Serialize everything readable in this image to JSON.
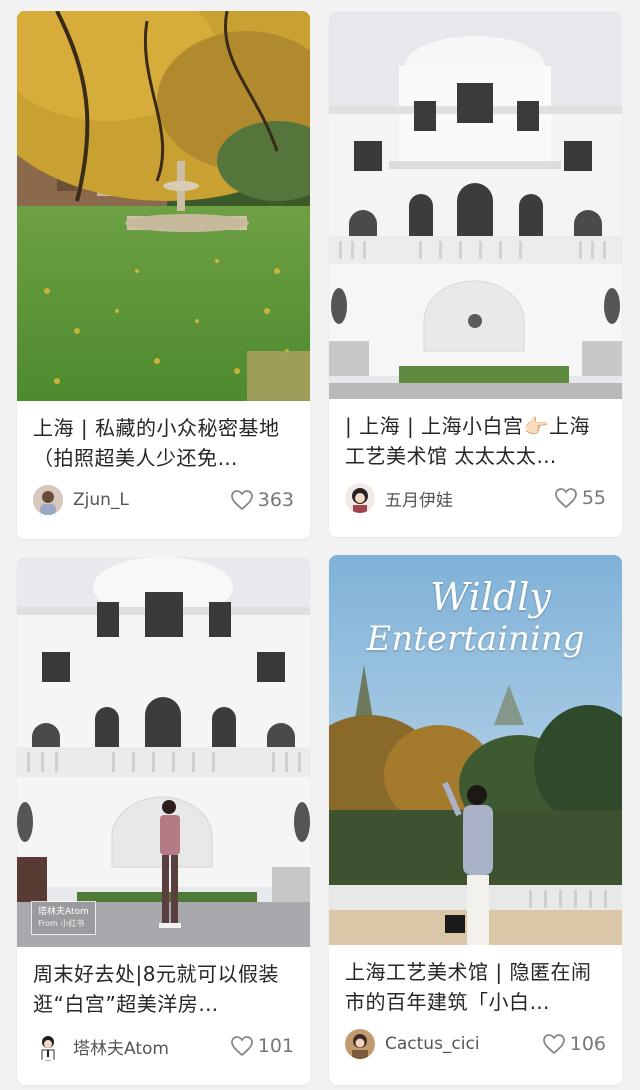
{
  "cards": [
    {
      "title": "上海 | 私藏的小众秘密基地（拍照超美人少还免…",
      "author": "Zjun_L",
      "likes": "363",
      "image_icon": "garden-photo"
    },
    {
      "title": "| 上海 | 上海小白宫👉🏻上海工艺美术馆 太太太太…",
      "author": "五月伊娃",
      "likes": "55",
      "image_icon": "white-palace-photo"
    },
    {
      "title": "周末好去处|8元就可以假装逛“白宫”超美洋房…",
      "author": "塔林夫Atom",
      "likes": "101",
      "image_icon": "white-palace-person-photo",
      "watermark": {
        "line1": "塔林夫Atom",
        "line2": "From 小红书"
      }
    },
    {
      "title": "上海工艺美术馆 | 隐匿在闹市的百年建筑「小白…",
      "author": "Cactus_cici",
      "likes": "106",
      "image_icon": "wildly-entertaining-photo",
      "overlay_text": {
        "line1": "Wildly",
        "line2": "Entertaining"
      }
    }
  ],
  "colors": {
    "background": "#f2f2f2",
    "card": "#ffffff",
    "text": "#262626",
    "muted": "#777777"
  }
}
